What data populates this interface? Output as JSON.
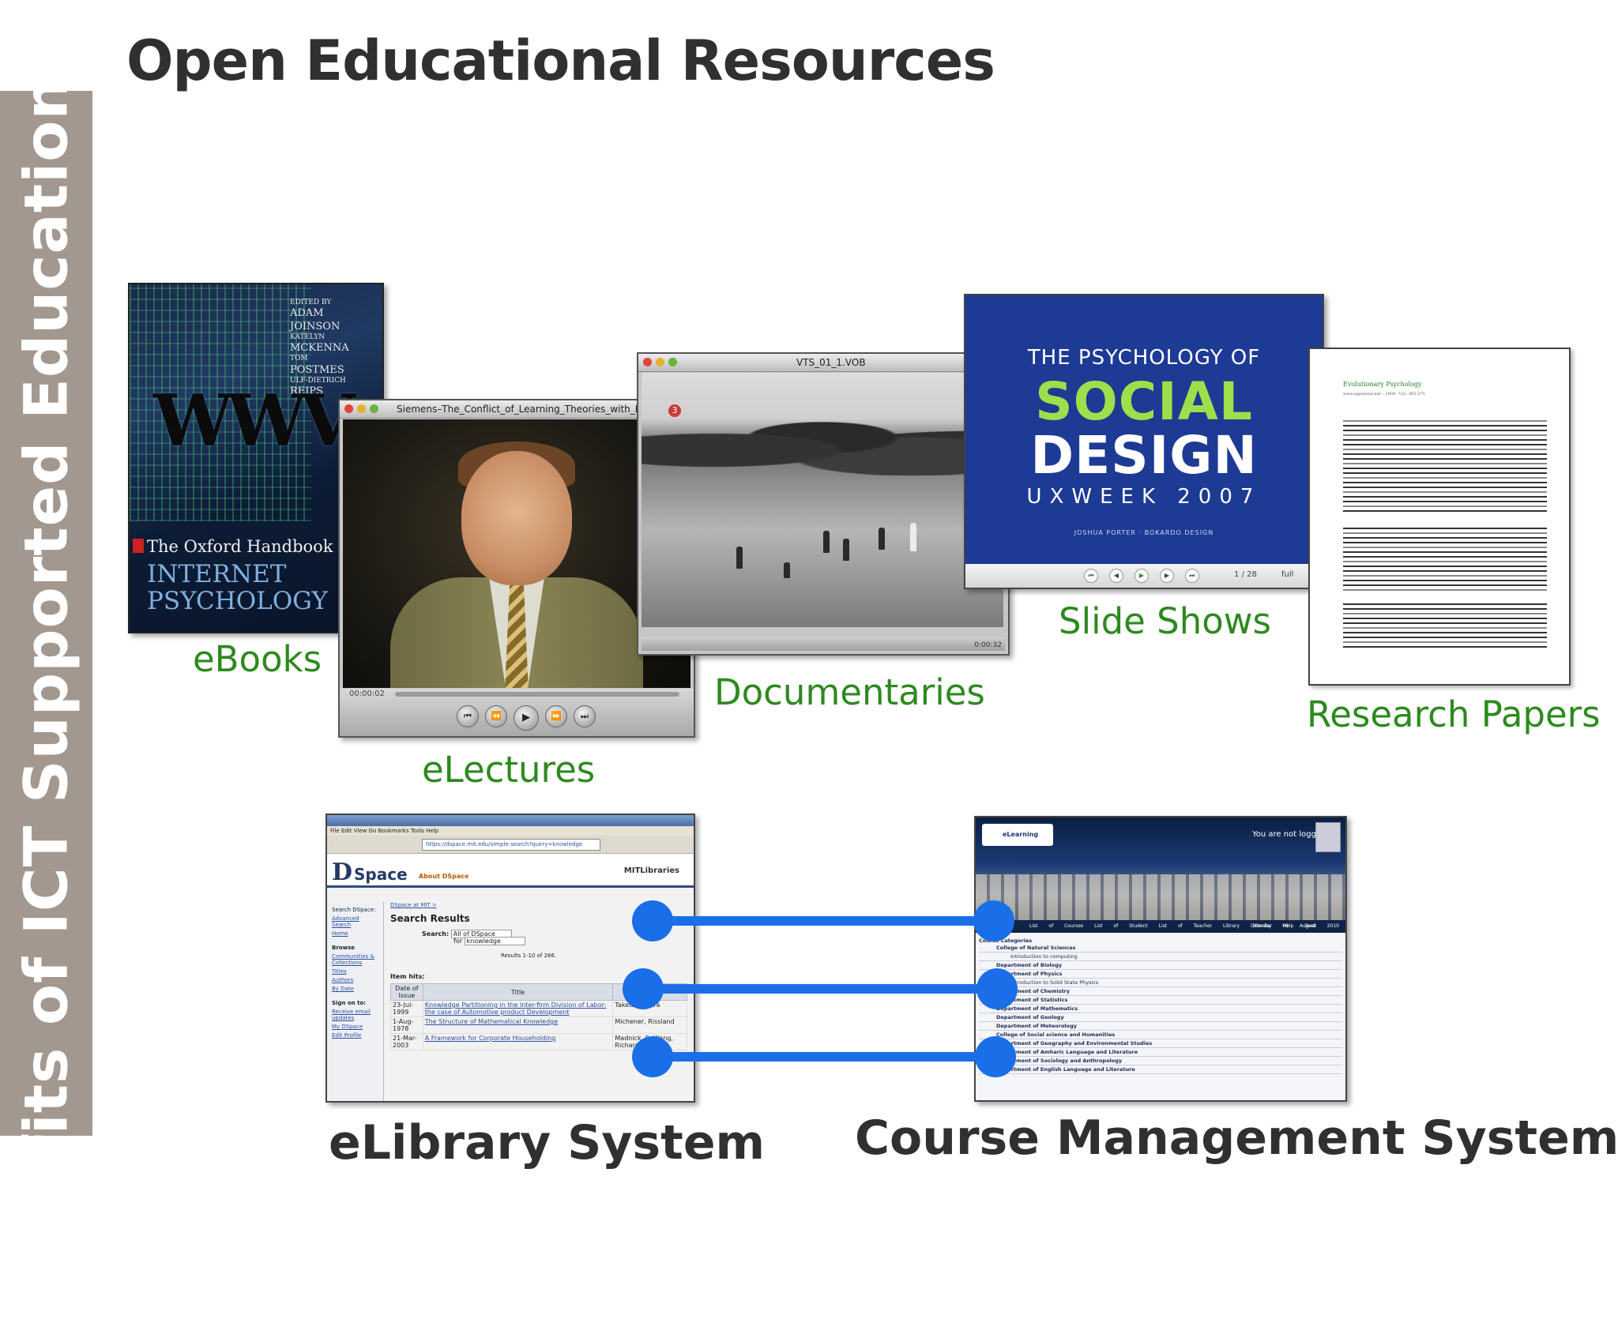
{
  "page": {
    "title": "Open Educational Resources",
    "sidebar_label": "Benefits of ICT Supported Education"
  },
  "captions": {
    "ebooks": "eBooks",
    "electures": "eLectures",
    "documentaries": "Documentaries",
    "slideshows": "Slide Shows",
    "research_papers": "Research Papers",
    "elibrary": "eLibrary System",
    "course_mgmt": "Course Management System"
  },
  "ebook": {
    "edited_by": "EDITED BY",
    "authors": [
      "ADAM",
      "JOINSON",
      "KATELYN",
      "McKENNA",
      "TOM",
      "POSTMES",
      "ULF-DIETRICH",
      "REIPS"
    ],
    "wwv": "WWV",
    "title_line": "The Oxford Handbook o",
    "subtitle": "INTERNET\nPSYCHOLOGY"
  },
  "lecture": {
    "window_title": "Siemens–The_Conflict_of_Learning_Theories_with_Human_",
    "timecode": "00:00:02"
  },
  "documentary": {
    "window_title": "VTS_01_1.VOB",
    "marker": "3",
    "time": "0:00:32"
  },
  "slideshow": {
    "line1": "THE PSYCHOLOGY OF",
    "line2": "SOCIAL",
    "line3": "DESIGN",
    "line4": "UXWEEK 2007",
    "line5": "JOSHUA PORTER · BOKARDO DESIGN",
    "page_current": "1",
    "page_total": "/ 28",
    "full_label": "full"
  },
  "paper": {
    "journal": "Evolutionary Psychology",
    "url": "www.epjournal.net – 2009. 7(3): 365-375"
  },
  "elibrary": {
    "url": "https://dspace.mit.edu/simple-search?query=knowledge",
    "logo_d": "D",
    "logo_space": "Space",
    "about": "About DSpace",
    "mit": "MITLibraries",
    "breadcrumb": "DSpace at MIT >",
    "search_results": "Search Results",
    "search_label": "Search:",
    "search_scope": "All of DSpace",
    "for_label": "for",
    "query": "knowledge",
    "results_text": "Results 1-10 of 266.",
    "item_hits": "Item hits:",
    "sidebar": {
      "search_label": "Search DSpace:",
      "advanced": "Advanced Search",
      "home": "Home",
      "browse": "Browse",
      "communities": "Communities & Collections",
      "titles": "Titles",
      "authors": "Authors",
      "by_date": "By Date",
      "sign_on": "Sign on to:",
      "receive_email": "Receive email updates",
      "my_dspace": "My DSpace",
      "edit_profile": "Edit Profile"
    },
    "columns": [
      "Date of Issue",
      "Title",
      "Authors"
    ],
    "rows": [
      [
        "23-Jul-1999",
        "Knowledge Partitioning in the Inter-firm Division of Labor: the case of Automotive product Development",
        "Takeishi, Akira"
      ],
      [
        "1-Aug-1978",
        "The Structure of Mathematical Knowledge",
        "Michener, Rissland"
      ],
      [
        "21-Mar-2003",
        "A Framework for Corporate Householding",
        "Madnick, S; Wang, Richard; Zhang"
      ]
    ]
  },
  "cms": {
    "logo_text": "eLearning Site",
    "not_logged": "You are not logged in.",
    "menu": "List of Courses  List of Student  List of Teacher  Library  Calendar  Help Desk",
    "date": "Monday 09 August 2010",
    "heading": "Course Categories",
    "rows": [
      {
        "text": "College of Natural Sciences",
        "cat": true
      },
      {
        "text": "Introduction to computing",
        "cat": false
      },
      {
        "text": "Department of Biology",
        "cat": true
      },
      {
        "text": "Department of Physics",
        "cat": true
      },
      {
        "text": "Introduction to Solid State Physics",
        "cat": false
      },
      {
        "text": "Department of Chemistry",
        "cat": true
      },
      {
        "text": "Department of Statistics",
        "cat": true
      },
      {
        "text": "Department of Mathematics",
        "cat": true
      },
      {
        "text": "Department of Geology",
        "cat": true
      },
      {
        "text": "Department of Meteorology",
        "cat": true
      },
      {
        "text": "College of Social science and Humanities",
        "cat": true
      },
      {
        "text": "Department of Geography and Environmental Studies",
        "cat": true
      },
      {
        "text": "Department of Amharic Language and Literature",
        "cat": true
      },
      {
        "text": "Department of Sociology and Anthropology",
        "cat": true
      },
      {
        "text": "Department of English Language and Literature",
        "cat": true
      }
    ]
  },
  "colors": {
    "caption_green": "#2d8a1e",
    "connector_blue": "#1a6ee8",
    "sidebar_bg": "#a39890",
    "slide_bg": "#1d3a94"
  }
}
